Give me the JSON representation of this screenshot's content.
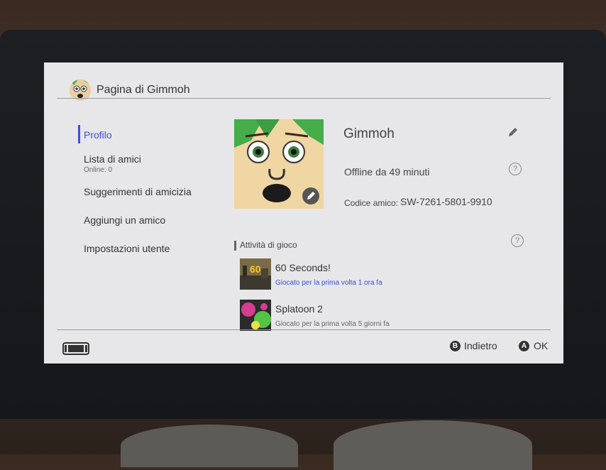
{
  "header": {
    "title": "Pagina di Gimmoh"
  },
  "nav": {
    "items": [
      {
        "label": "Profilo"
      },
      {
        "label": "Lista di amici",
        "sub": "Online: 0"
      },
      {
        "label": "Suggerimenti di amicizia"
      },
      {
        "label": "Aggiungi un amico"
      },
      {
        "label": "Impostazioni utente"
      }
    ]
  },
  "profile": {
    "username": "Gimmoh",
    "status": "Offline da 49 minuti",
    "friend_code_label": "Codice amico:",
    "friend_code": "SW-7261-5801-9910"
  },
  "activity": {
    "title": "Attività di gioco",
    "games": [
      {
        "title": "60 Seconds!",
        "subtitle": "Giocato per la prima volta 1 ora fa",
        "thumb_text": "60"
      },
      {
        "title": "Splatoon 2",
        "subtitle": "Giocato per la prima volta 5 giorni fa"
      }
    ]
  },
  "footer": {
    "back_key": "B",
    "back_label": "Indietro",
    "ok_key": "A",
    "ok_label": "OK"
  },
  "colors": {
    "accent": "#3b4de0",
    "screen_bg": "#e7e7ea"
  }
}
